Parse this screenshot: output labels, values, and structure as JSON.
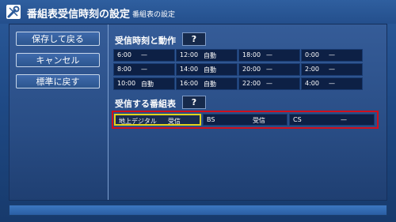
{
  "title": {
    "main": "番組表受信時刻の設定",
    "sub": "番組表の設定",
    "icon": "wrench-screwdriver-icon"
  },
  "sidebar": {
    "buttons": [
      {
        "label": "保存して戻る"
      },
      {
        "label": "キャンセル"
      },
      {
        "label": "標準に戻す"
      }
    ]
  },
  "schedule": {
    "heading": "受信時刻と動作",
    "help_label": "?",
    "rows": [
      [
        {
          "time": "6:00",
          "action": "—"
        },
        {
          "time": "12:00",
          "action": "自動"
        },
        {
          "time": "18:00",
          "action": "—"
        },
        {
          "time": "0:00",
          "action": "—"
        }
      ],
      [
        {
          "time": "8:00",
          "action": "—"
        },
        {
          "time": "14:00",
          "action": "自動"
        },
        {
          "time": "20:00",
          "action": "—"
        },
        {
          "time": "2:00",
          "action": "—"
        }
      ],
      [
        {
          "time": "10:00",
          "action": "自動"
        },
        {
          "time": "16:00",
          "action": "自動"
        },
        {
          "time": "22:00",
          "action": "—"
        },
        {
          "time": "4:00",
          "action": "—"
        }
      ]
    ]
  },
  "channels": {
    "heading": "受信する番組表",
    "help_label": "?",
    "items": [
      {
        "name": "地上デジタル",
        "status": "受信"
      },
      {
        "name": "BS",
        "status": "受信"
      },
      {
        "name": "CS",
        "status": "—"
      }
    ]
  },
  "colors": {
    "highlight_outline": "#d10f1c",
    "focus_outline": "#e2d21b"
  }
}
